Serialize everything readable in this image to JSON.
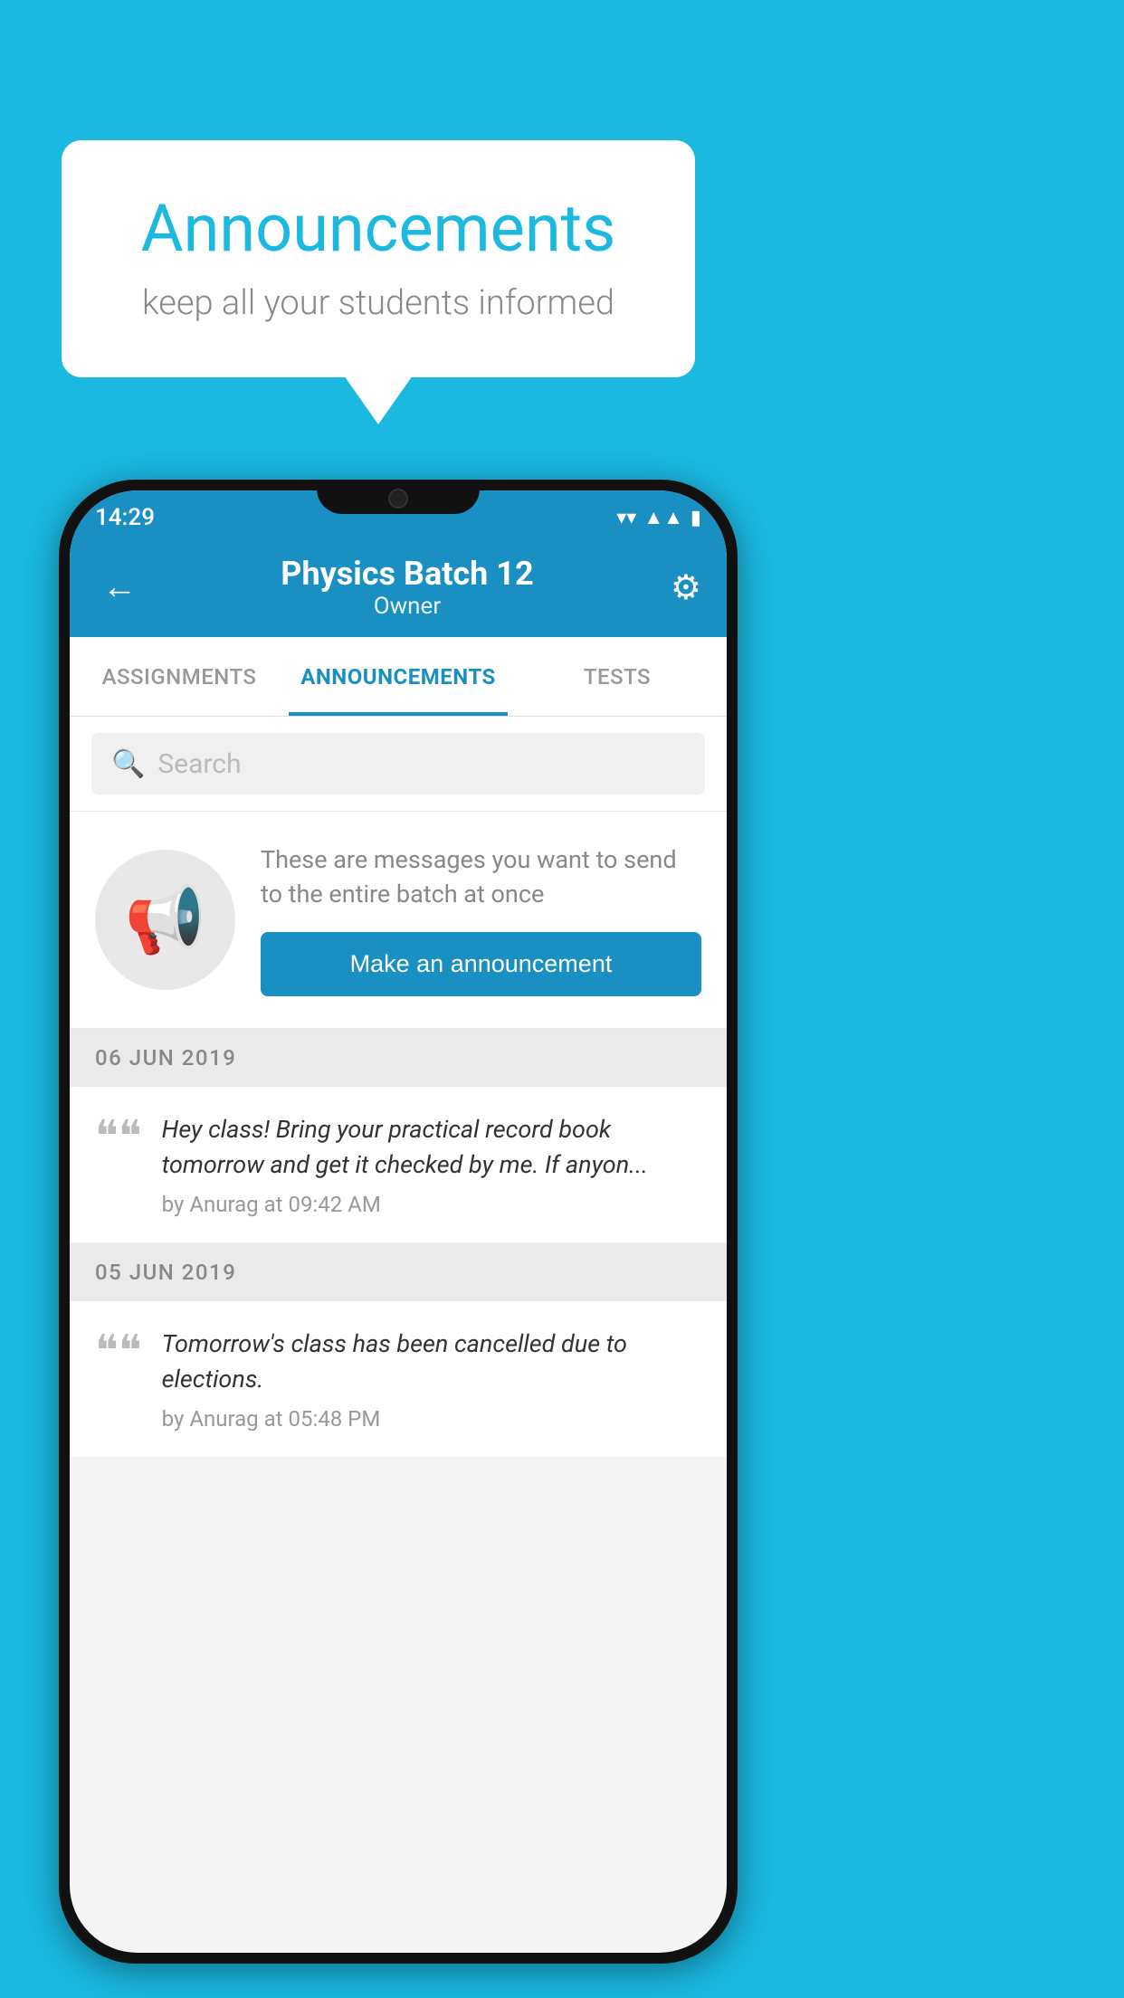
{
  "background_color": "#1BB8E0",
  "bubble": {
    "title": "Announcements",
    "subtitle": "keep all your students informed"
  },
  "phone": {
    "status_bar": {
      "time": "14:29"
    },
    "header": {
      "title": "Physics Batch 12",
      "subtitle": "Owner",
      "back_label": "←",
      "gear_label": "⚙"
    },
    "tabs": [
      {
        "label": "ASSIGNMENTS",
        "active": false
      },
      {
        "label": "ANNOUNCEMENTS",
        "active": true
      },
      {
        "label": "TESTS",
        "active": false
      },
      {
        "label": "...",
        "active": false
      }
    ],
    "search": {
      "placeholder": "Search"
    },
    "promo": {
      "description": "These are messages you want to send to the entire batch at once",
      "button_label": "Make an announcement"
    },
    "announcements": [
      {
        "date": "06  JUN  2019",
        "text": "Hey class! Bring your practical record book tomorrow and get it checked by me. If anyon...",
        "meta": "by Anurag at 09:42 AM"
      },
      {
        "date": "05  JUN  2019",
        "text": "Tomorrow's class has been cancelled due to elections.",
        "meta": "by Anurag at 05:48 PM"
      }
    ]
  }
}
